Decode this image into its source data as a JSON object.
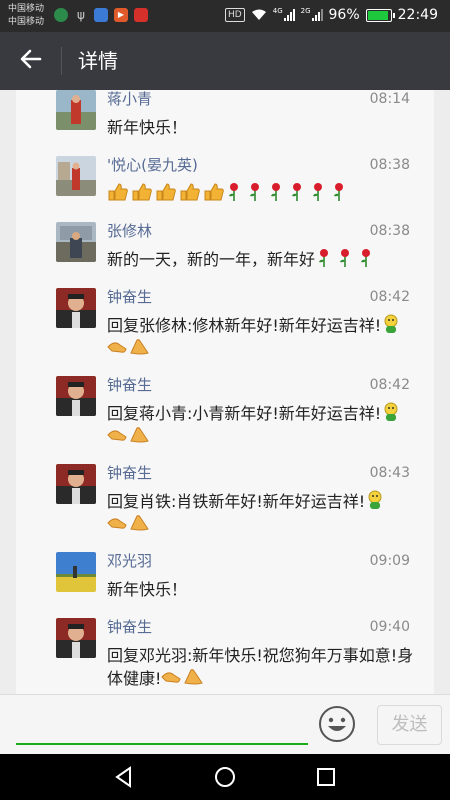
{
  "status": {
    "carrier1": "中国移动",
    "carrier2": "中国移动",
    "battery": "96%",
    "time": "22:49",
    "net1": "4G",
    "net2": "2G"
  },
  "appbar": {
    "title": "详情",
    "back_icon": "arrow-left-icon"
  },
  "comments": [
    {
      "name": "蒋小青",
      "time": "08:14",
      "text": "新年快乐！"
    },
    {
      "name": "'悦心(晏九英)",
      "time": "08:38",
      "text": ""
    },
    {
      "name": "张修林",
      "time": "08:38",
      "text": "新的一天，新的一年，新年好"
    },
    {
      "name": "钟奋生",
      "time": "08:42",
      "text": "回复张修林:修林新年好!新年好运吉祥!"
    },
    {
      "name": "钟奋生",
      "time": "08:42",
      "text": "回复蒋小青:小青新年好!新年好运吉祥!"
    },
    {
      "name": "钟奋生",
      "time": "08:43",
      "text": "回复肖铁:肖铁新年好!新年好运吉祥!"
    },
    {
      "name": "邓光羽",
      "time": "09:09",
      "text": "新年快乐！"
    },
    {
      "name": "钟奋生",
      "time": "09:40",
      "text": "回复邓光羽:新年快乐!祝您狗年万事如意!身体健康!"
    }
  ],
  "input": {
    "placeholder": "",
    "send_label": "发送"
  },
  "colors": {
    "accent": "#1aad19",
    "name": "#576b95",
    "appbar": "#393a3f"
  }
}
